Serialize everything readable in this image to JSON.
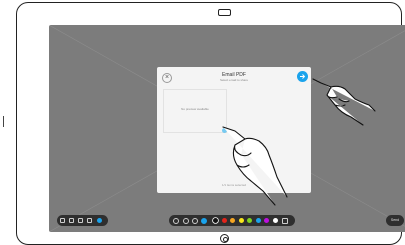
{
  "dialog": {
    "title": "Email PDF",
    "subtitle": "Select email to share",
    "close_glyph": "×",
    "preview_text": "No preview available",
    "footer_text": "1/1 items selected",
    "accent_color": "#1aa3ec"
  },
  "icons": {
    "close": "close-icon",
    "send": "send-arrow-icon",
    "hand": "pointing-hand-icon"
  },
  "toolbar": {
    "left_tools": [
      "undo-icon",
      "layers-icon",
      "page-icon",
      "copy-icon",
      "shape-icon"
    ],
    "center_tools": [
      "undo-icon",
      "pen-icon",
      "eraser-icon",
      "brush-icon"
    ],
    "colors": [
      "#111111",
      "#e2231a",
      "#f5a623",
      "#f8e71c",
      "#7ed321",
      "#1aa3ec",
      "#bd10e0",
      "#ffffff"
    ],
    "selected_color": "#111111",
    "send_label": "Send"
  }
}
